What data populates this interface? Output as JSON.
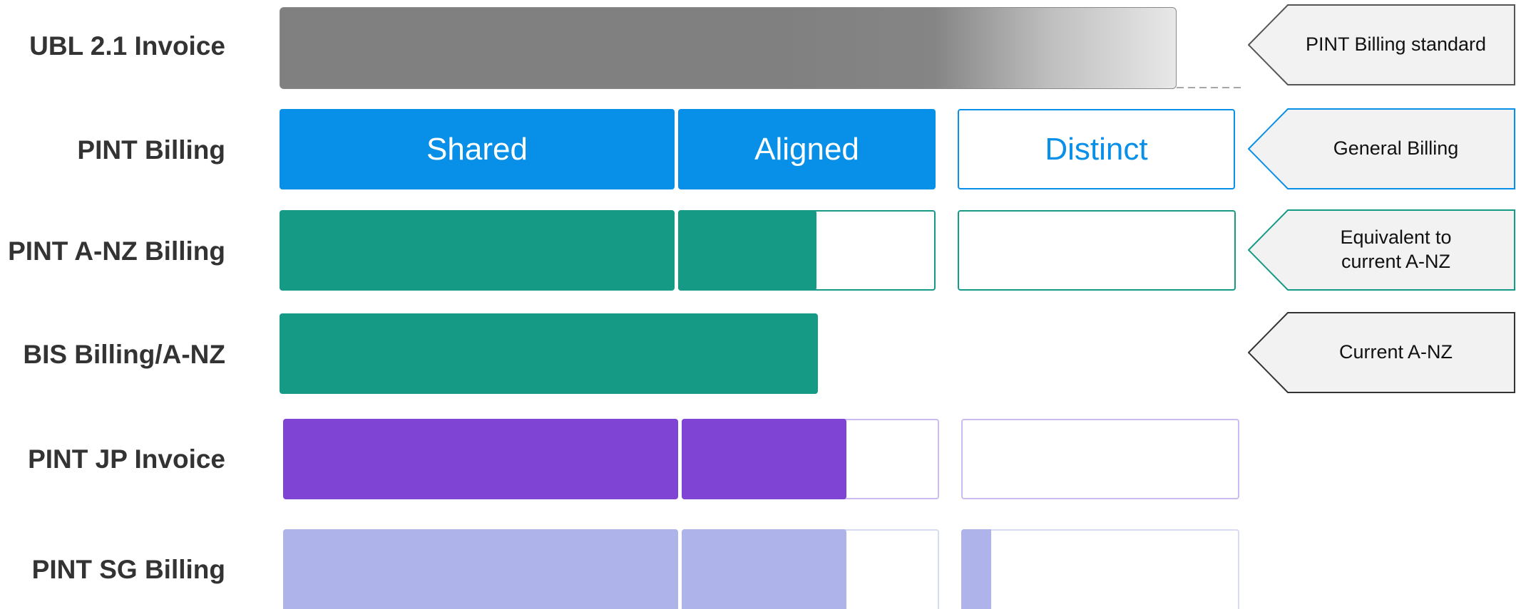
{
  "colors": {
    "ubl_gray": "#808080",
    "pint_blue": "#0890e8",
    "anz_teal": "#159a86",
    "jp_purple": "#7f44d3",
    "sg_lavender": "#aeb3ea",
    "callout_fill": "#f2f2f2"
  },
  "rows": [
    {
      "id": "ubl",
      "label": "UBL 2.1 Invoice"
    },
    {
      "id": "pint-billing",
      "label": "PINT Billing"
    },
    {
      "id": "pint-anz",
      "label": "PINT A-NZ Billing"
    },
    {
      "id": "bis-anz",
      "label": "BIS Billing/A-NZ"
    },
    {
      "id": "pint-jp",
      "label": "PINT JP Invoice"
    },
    {
      "id": "pint-sg",
      "label": "PINT SG Billing"
    }
  ],
  "segments": {
    "shared": "Shared",
    "aligned": "Aligned",
    "distinct": "Distinct"
  },
  "callouts": [
    {
      "id": "pint-standard",
      "text": "PINT Billing standard"
    },
    {
      "id": "general",
      "text": "General Billing"
    },
    {
      "id": "equivalent",
      "text": "Equivalent to\ncurrent A-NZ"
    },
    {
      "id": "current",
      "text": "Current A-NZ"
    }
  ]
}
